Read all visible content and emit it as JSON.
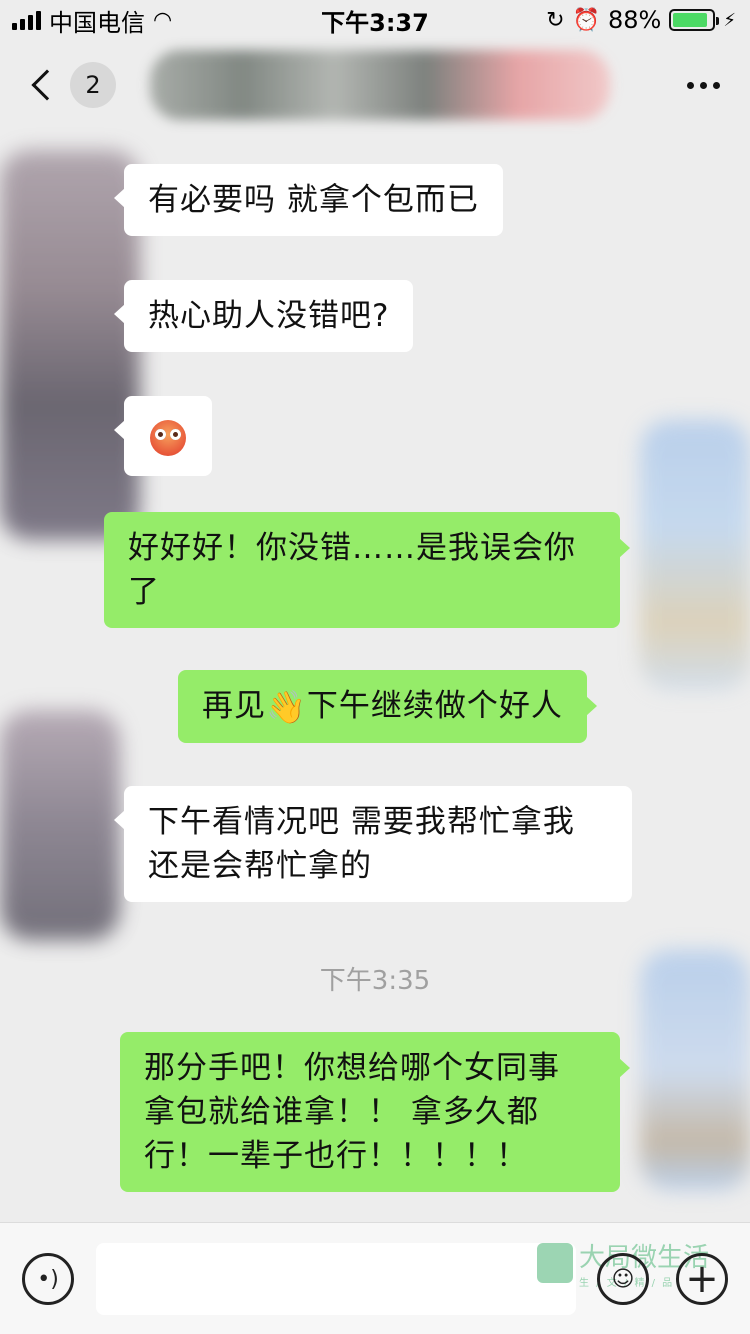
{
  "status_bar": {
    "carrier": "中国电信",
    "time": "下午3:37",
    "battery": "88%",
    "battery_level": 0.88
  },
  "nav": {
    "unread_count": "2"
  },
  "messages": [
    {
      "side": "in",
      "text": "有必要吗 就拿个包而已"
    },
    {
      "side": "in",
      "text": "热心助人没错吧?"
    },
    {
      "side": "in",
      "emoji": "flushed-face"
    },
    {
      "side": "out",
      "text_line1": "好好好！你没错……是我误会你",
      "text_line2": "了"
    },
    {
      "side": "out",
      "text_before": "再见",
      "emoji": "👋",
      "text_after": "下午继续做个好人"
    },
    {
      "side": "in",
      "text_line1": "下午看情况吧 需要我帮忙拿我",
      "text_line2": "还是会帮忙拿的"
    },
    {
      "side": "out",
      "text_line1": "那分手吧！你想给哪个女同事",
      "text_line2": "拿包就给谁拿！！ 拿多久都",
      "text_line3": "行！一辈子也行！！！！！"
    }
  ],
  "timestamp": "下午3:35",
  "watermark": {
    "text": "大局微生活",
    "subtext": "生 / 文 / 精 / 品"
  },
  "colors": {
    "incoming_bubble": "#ffffff",
    "outgoing_bubble": "#95ec69",
    "background": "#ededed"
  }
}
